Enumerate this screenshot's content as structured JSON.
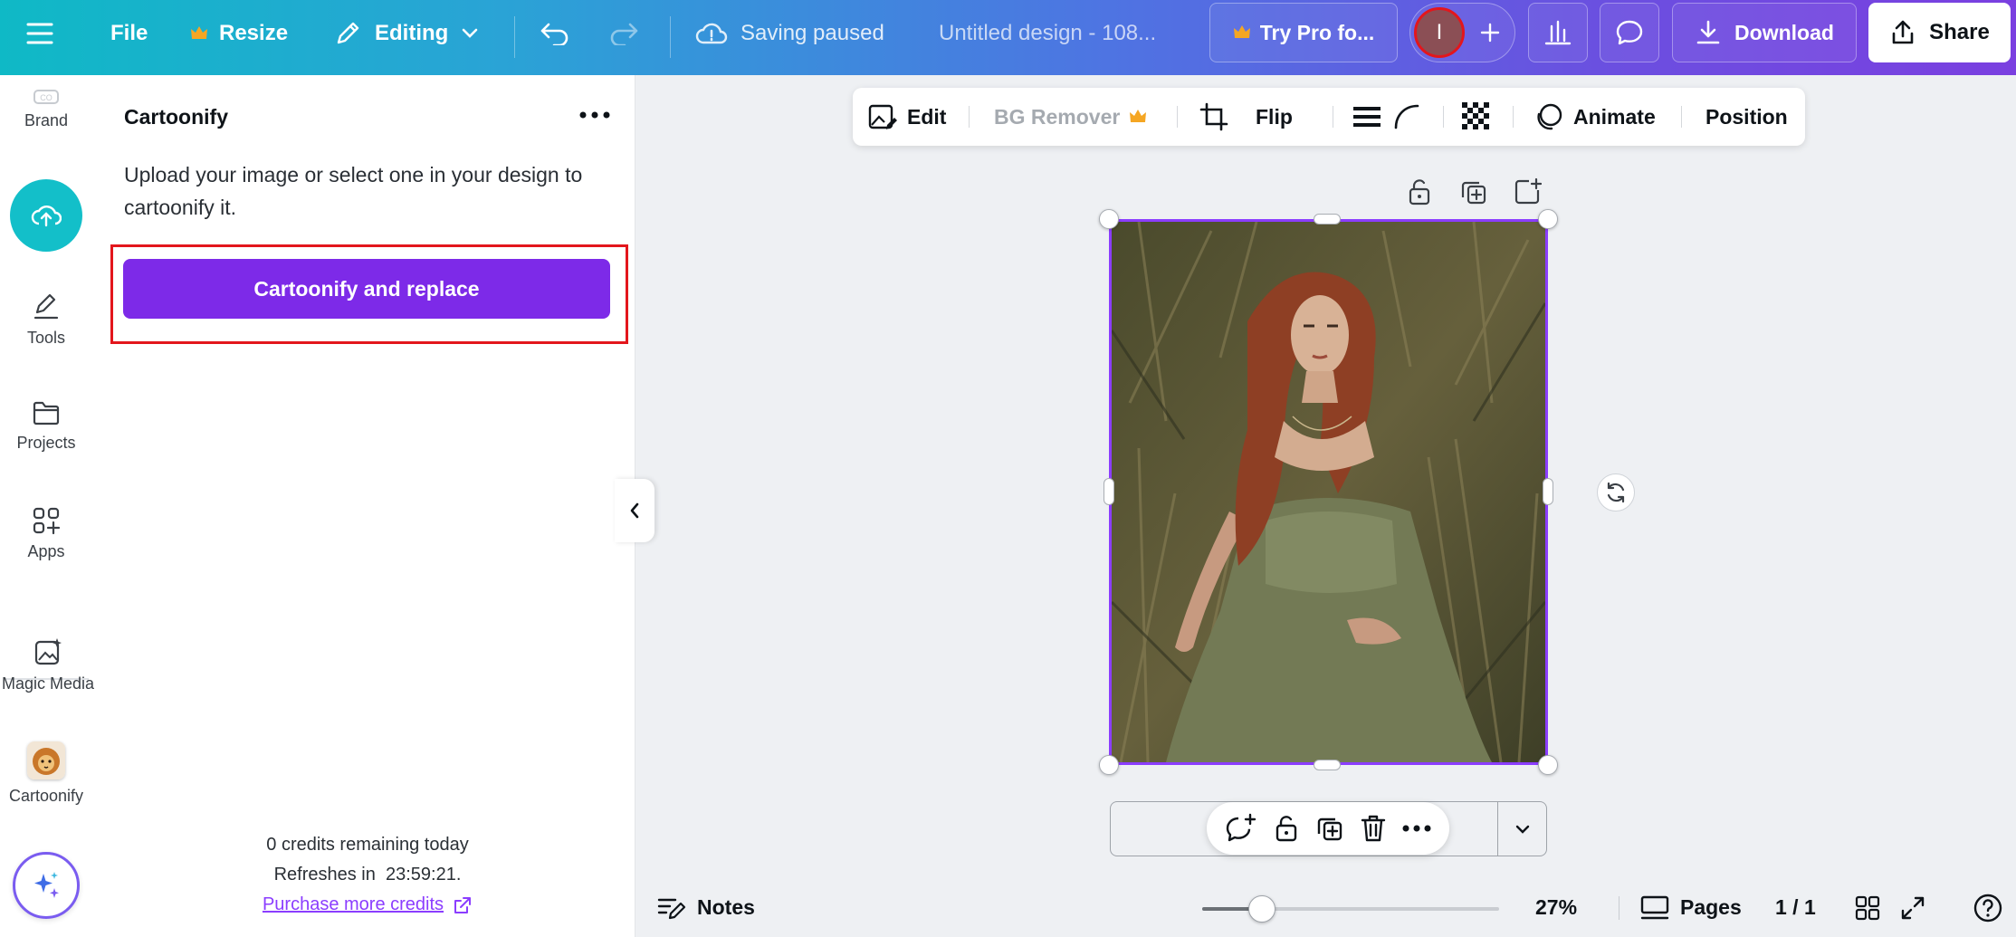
{
  "topbar": {
    "file_label": "File",
    "resize_label": "Resize",
    "editing_label": "Editing",
    "saving_status": "Saving paused",
    "design_title": "Untitled design - 108...",
    "try_pro_label": "Try Pro fo...",
    "avatar_initial": "I",
    "download_label": "Download",
    "share_label": "Share"
  },
  "rail": {
    "brand": "Brand",
    "tools": "Tools",
    "projects": "Projects",
    "apps": "Apps",
    "magic_media": "Magic Media",
    "cartoonify": "Cartoonify"
  },
  "panel": {
    "title": "Cartoonify",
    "description": "Upload your image or select one in your design to cartoonify it.",
    "button_label": "Cartoonify and replace",
    "credits_line": "0 credits remaining today",
    "refresh_line": "Refreshes in  23:59:21.",
    "purchase_link": "Purchase more credits"
  },
  "image_toolbar": {
    "edit": "Edit",
    "bg_remover": "BG Remover",
    "flip": "Flip",
    "animate": "Animate",
    "position": "Position"
  },
  "bottombar": {
    "notes": "Notes",
    "zoom_percent_label": "27%",
    "zoom_fraction": 0.2,
    "pages_label": "Pages",
    "page_count": "1 / 1"
  },
  "colors": {
    "accent_purple": "#7d2ae8",
    "highlight_red": "#e3161c",
    "crown_gold": "#f5a623",
    "link_purple": "#8b3dff"
  }
}
